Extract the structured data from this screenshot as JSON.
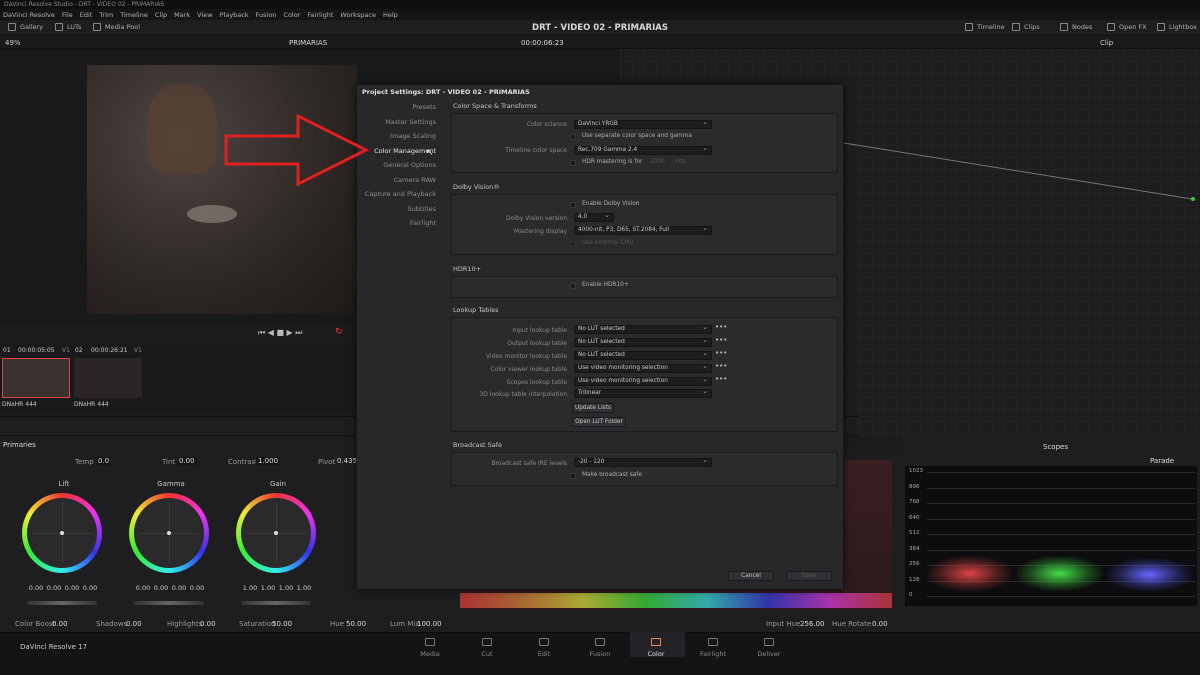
{
  "window_title": "DaVinci Resolve Studio - DRT - VIDEO 02 - PRIMARIAS",
  "menu": [
    "DaVinci Resolve",
    "File",
    "Edit",
    "Trim",
    "Timeline",
    "Clip",
    "Mark",
    "View",
    "Playback",
    "Fusion",
    "Color",
    "Fairlight",
    "Workspace",
    "Help"
  ],
  "project_title": "DRT - VIDEO 02 - PRIMARIAS",
  "toolbar": {
    "gallery": "Gallery",
    "luts": "LUTs",
    "media_pool": "Media Pool",
    "timeline": "Timeline",
    "clips": "Clips",
    "nodes": "Nodes",
    "open_fx": "Open FX",
    "lightbox": "Lightbox"
  },
  "viewer": {
    "zoom": "49%",
    "name": "PRIMARIAS",
    "timecode": "00:00:06:23",
    "clip_mode": "Clip"
  },
  "clips": [
    {
      "num": "01",
      "tc": "00:00:05:05",
      "track": "V1",
      "codec": "DNxHR 444"
    },
    {
      "num": "02",
      "tc": "00:00:26:21",
      "track": "V1",
      "codec": "DNxHR 444"
    }
  ],
  "primaries": {
    "title": "Primaries",
    "temp_label": "Temp",
    "temp": "0.0",
    "tint_label": "Tint",
    "tint": "0.00",
    "contrast_label": "Contrast",
    "contrast": "1.000",
    "pivot_label": "Pivot",
    "pivot": "0.435",
    "wheels": [
      {
        "name": "Lift",
        "vals": [
          "0.00",
          "0.00",
          "0.00",
          "0.00"
        ]
      },
      {
        "name": "Gamma",
        "vals": [
          "0.00",
          "0.00",
          "0.00",
          "0.00"
        ]
      },
      {
        "name": "Gain",
        "vals": [
          "1.00",
          "1.00",
          "1.00",
          "1.00"
        ]
      }
    ],
    "color_boost_label": "Color Boost",
    "color_boost": "0.00",
    "shadows_label": "Shadows",
    "shadows": "0.00",
    "highlights_label": "Highlights",
    "highlights": "0.00",
    "saturation_label": "Saturation",
    "saturation": "50.00",
    "hue_label": "Hue",
    "hue": "50.00",
    "lum_mix_label": "Lum Mix",
    "lum_mix": "100.00"
  },
  "curves": {
    "input_hue_label": "Input Hue",
    "input_hue": "256.00",
    "hue_rotate_label": "Hue Rotate",
    "hue_rotate": "0.00"
  },
  "scopes": {
    "title": "Scopes",
    "mode": "Parade",
    "ticks": [
      "1023",
      "896",
      "768",
      "640",
      "512",
      "384",
      "256",
      "128",
      "0"
    ]
  },
  "pages": [
    "Media",
    "Cut",
    "Edit",
    "Fusion",
    "Color",
    "Fairlight",
    "Deliver"
  ],
  "app_name": "DaVinci Resolve 17",
  "dialog": {
    "title": "Project Settings:  DRT - VIDEO 02 - PRIMARIAS",
    "nav": [
      "Presets",
      "Master Settings",
      "Image Scaling",
      "Color Management",
      "General Options",
      "Camera RAW",
      "Capture and Playback",
      "Subtitles",
      "Fairlight"
    ],
    "selected_nav": "Color Management",
    "cs": {
      "heading": "Color Space & Transforms",
      "science_label": "Color science",
      "science": "DaVinci YRGB",
      "separate": "Use separate color space and gamma",
      "tl_label": "Timeline color space",
      "tl": "Rec.709 Gamma 2.4",
      "hdr": "HDR mastering is for",
      "hdr_val": "1000",
      "hdr_unit": "nits"
    },
    "dv": {
      "heading": "Dolby Vision®",
      "enable": "Enable Dolby Vision",
      "ver_label": "Dolby Vision version",
      "ver": "4.0",
      "md_label": "Mastering display",
      "md": "4000-nit, P3, D65, ST.2084, Full",
      "ext": "Use external CMU"
    },
    "hdr10": {
      "heading": "HDR10+",
      "enable": "Enable HDR10+"
    },
    "lt": {
      "heading": "Lookup Tables",
      "rows": [
        {
          "l": "Input lookup table",
          "v": "No LUT selected"
        },
        {
          "l": "Output lookup table",
          "v": "No LUT selected"
        },
        {
          "l": "Video monitor lookup table",
          "v": "No LUT selected"
        },
        {
          "l": "Color viewer lookup table",
          "v": "Use video monitoring selection"
        },
        {
          "l": "Scopes lookup table",
          "v": "Use video monitoring selection"
        }
      ],
      "interp_label": "3D lookup table interpolation",
      "interp": "Trilinear",
      "update": "Update Lists",
      "open": "Open LUT Folder"
    },
    "bs": {
      "heading": "Broadcast Safe",
      "ire_label": "Broadcast safe IRE levels",
      "ire": "-20 - 120",
      "make": "Make broadcast safe"
    },
    "cancel": "Cancel",
    "save": "Save"
  }
}
